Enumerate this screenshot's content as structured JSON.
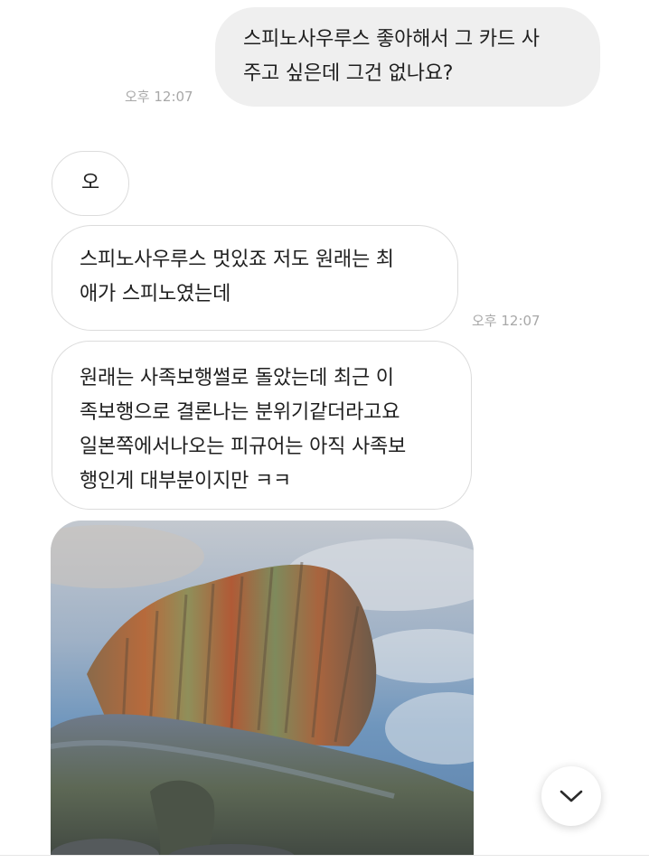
{
  "messages": [
    {
      "id": "sent-1",
      "direction": "sent",
      "lines": [
        "스피노사우루스 좋아해서 그 카드 사",
        "주고 싶은데 그건 없나요?"
      ],
      "time": "오후 12:07"
    },
    {
      "id": "recv-1",
      "direction": "received",
      "lines": [
        "오"
      ]
    },
    {
      "id": "recv-2",
      "direction": "received",
      "lines": [
        "스피노사우루스 멋있죠 저도 원래는 최",
        "애가 스피노였는데"
      ],
      "time": "오후 12:07"
    },
    {
      "id": "recv-3",
      "direction": "received",
      "lines": [
        "원래는 사족보행썰로 돌았는데 최근 이",
        "족보행으로 결론나는 분위기같더라고요",
        "일본쪽에서나오는 피규어는 아직 사족보",
        "행인게 대부분이지만 ㅋㅋ"
      ]
    },
    {
      "id": "recv-4",
      "direction": "received",
      "type": "image",
      "image": "spinosaurus-illustration"
    }
  ],
  "scroll_button": {
    "icon": "chevron-down-icon"
  },
  "colors": {
    "sent_bubble": "#efefef",
    "received_border": "#dcdcdc",
    "timestamp": "#a8a8a8",
    "text": "#1f1f1f"
  }
}
